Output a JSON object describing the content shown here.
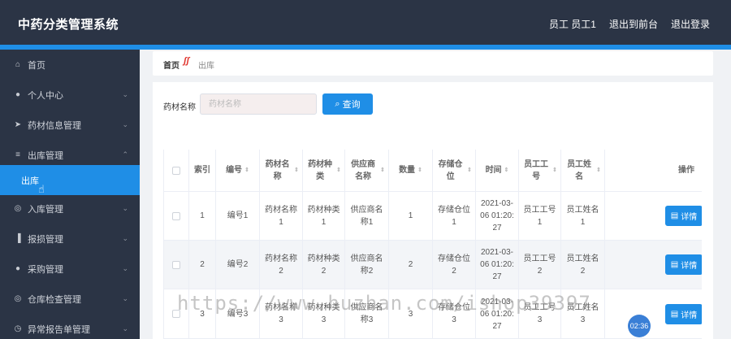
{
  "app": {
    "title": "中药分类管理系统",
    "user_label": "员工 员工1",
    "back_label": "退出到前台",
    "logout_label": "退出登录"
  },
  "sidebar": {
    "items": [
      {
        "label": "首页",
        "icon": "home-icon"
      },
      {
        "label": "个人中心",
        "icon": "user-icon"
      },
      {
        "label": "药材信息管理",
        "icon": "send-icon"
      },
      {
        "label": "出库管理",
        "icon": "menu-icon"
      },
      {
        "label": "出库",
        "icon": ""
      },
      {
        "label": "入库管理",
        "icon": "settings-icon"
      },
      {
        "label": "报损管理",
        "icon": "bar-chart-icon"
      },
      {
        "label": "采购管理",
        "icon": "location-icon"
      },
      {
        "label": "仓库检查管理",
        "icon": "settings-icon"
      },
      {
        "label": "异常报告单管理",
        "icon": "clock-icon"
      }
    ]
  },
  "breadcrumb": {
    "home": "首页",
    "current": "出库"
  },
  "search": {
    "label": "药材名称",
    "placeholder": "药材名称",
    "button": "查询"
  },
  "table": {
    "headers": [
      "索引",
      "编号",
      "药材名称",
      "药材种类",
      "供应商名称",
      "数量",
      "存储仓位",
      "时间",
      "员工工号",
      "员工姓名",
      "操作"
    ],
    "rows": [
      {
        "index": "1",
        "code": "编号1",
        "name": "药材名称1",
        "type": "药材种类1",
        "supplier": "供应商名称1",
        "qty": "1",
        "location": "存储仓位1",
        "time": "2021-03-06 01:20:27",
        "emp_no": "员工工号1",
        "emp_name": "员工姓名1",
        "action": "详情"
      },
      {
        "index": "2",
        "code": "编号2",
        "name": "药材名称2",
        "type": "药材种类2",
        "supplier": "供应商名称2",
        "qty": "2",
        "location": "存储仓位2",
        "time": "2021-03-06 01:20:27",
        "emp_no": "员工工号2",
        "emp_name": "员工姓名2",
        "action": "详情"
      },
      {
        "index": "3",
        "code": "编号3",
        "name": "药材名称3",
        "type": "药材种类3",
        "supplier": "供应商名称3",
        "qty": "3",
        "location": "存储仓位3",
        "time": "2021-03-06 01:20:27",
        "emp_no": "员工工号3",
        "emp_name": "员工姓名3",
        "action": "详情"
      }
    ]
  },
  "watermark": "https://www.huzhan.com/ishop39397",
  "clock": "02:36",
  "colors": {
    "topbar": "#2b3445",
    "accent": "#1f8ee6"
  }
}
